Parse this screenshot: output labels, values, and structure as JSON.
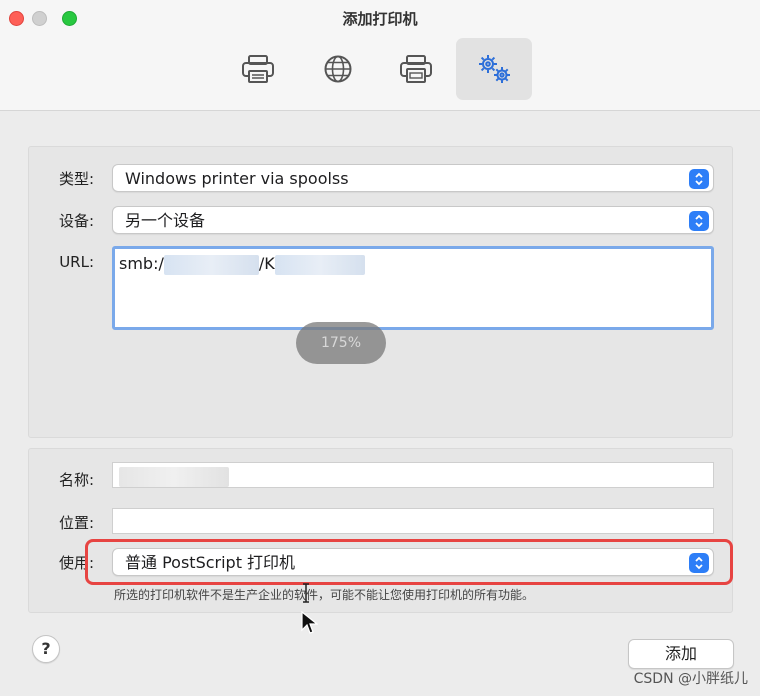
{
  "window": {
    "title": "添加打印机"
  },
  "toolbar": {
    "items": [
      {
        "icon": "printer-icon"
      },
      {
        "icon": "globe-icon"
      },
      {
        "icon": "printer-alt-icon"
      },
      {
        "icon": "gears-icon",
        "active": true
      }
    ]
  },
  "form": {
    "type_label": "类型:",
    "type_value": "Windows printer via spoolss",
    "device_label": "设备:",
    "device_value": "另一个设备",
    "url_label": "URL:",
    "url_prefix": "smb:/",
    "url_mid": "/K",
    "name_label": "名称:",
    "location_label": "位置:",
    "use_label": "使用:",
    "use_value": "普通 PostScript 打印机",
    "note": "所选的打印机软件不是生产企业的软件，可能不能让您使用打印机的所有功能。"
  },
  "zoom_indicator": "175%",
  "buttons": {
    "help": "?",
    "add": "添加"
  },
  "watermark": "CSDN @小胖纸儿",
  "colors": {
    "accent": "#2d7ef7",
    "highlight_box": "#e74442"
  }
}
